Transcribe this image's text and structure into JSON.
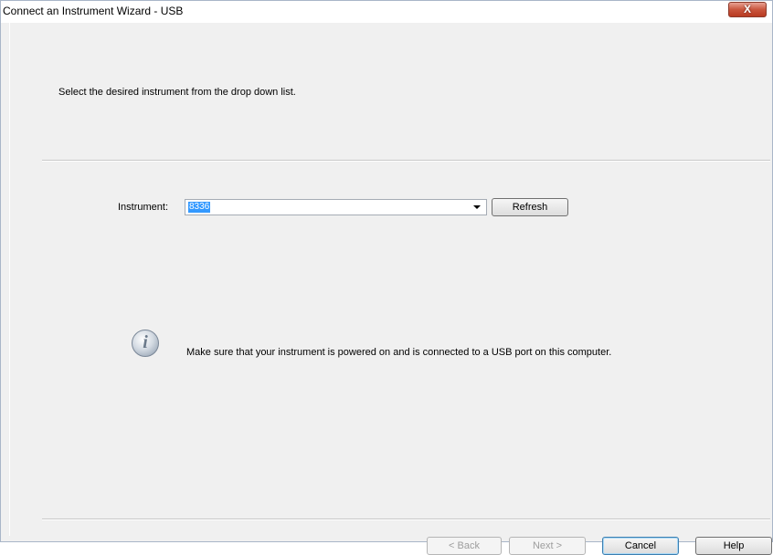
{
  "window": {
    "title": "Connect an Instrument Wizard - USB",
    "close_glyph": "X"
  },
  "page": {
    "prompt": "Select the desired instrument from the drop down list."
  },
  "instrument": {
    "label": "Instrument:",
    "selected_value": "8336",
    "refresh_label": "Refresh"
  },
  "info": {
    "icon": "info-icon",
    "message": "Make sure that your instrument is powered on and is connected to a USB port on this computer."
  },
  "buttons": {
    "back": "< Back",
    "next": "Next >",
    "cancel": "Cancel",
    "help": "Help"
  },
  "colors": {
    "selection": "#3399ff",
    "close_button": "#c9553d",
    "dialog_background": "#f0f0f0"
  }
}
